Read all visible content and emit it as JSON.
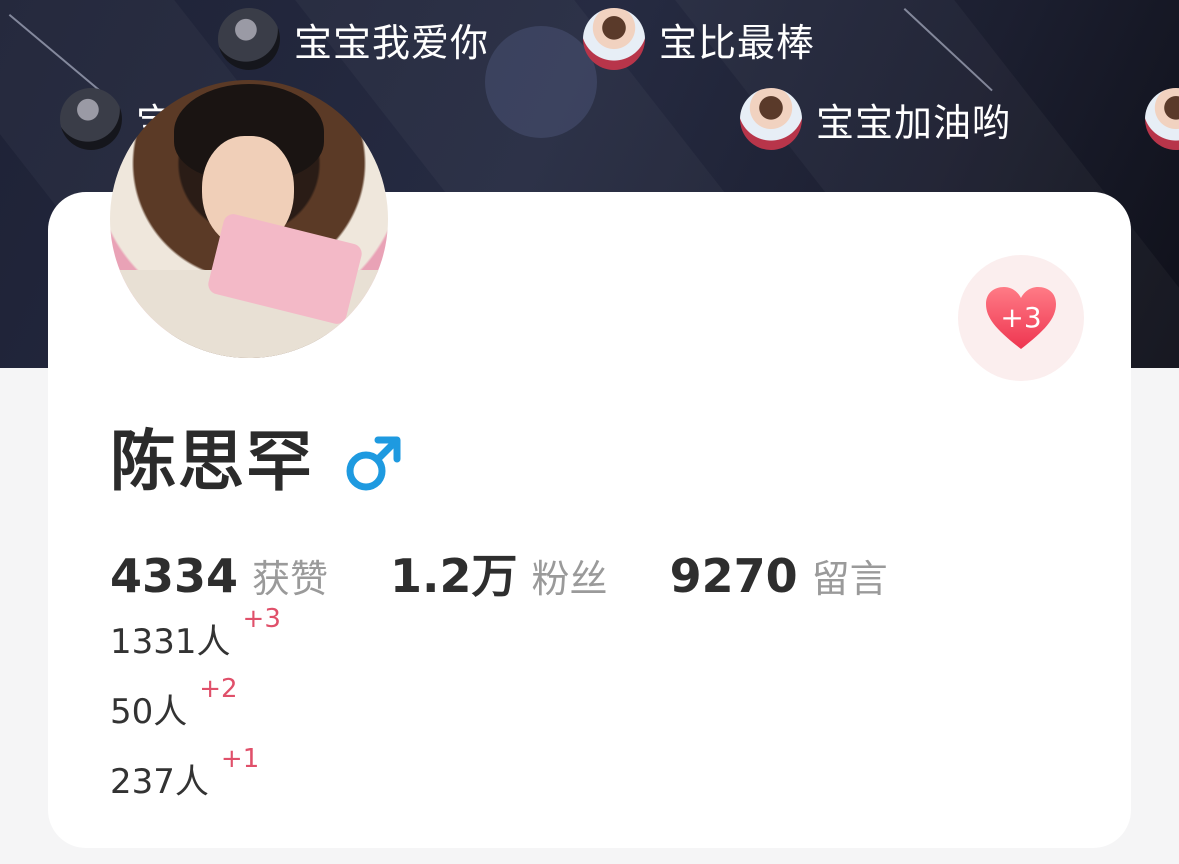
{
  "colors": {
    "banner_bg": "#22263a",
    "accent_red": "#e0506a",
    "gender_blue": "#1e9ae0",
    "heart_red": "#f04a5e"
  },
  "barrage": [
    {
      "avatar": "avatar-dark",
      "text": "宝宝我爱你"
    },
    {
      "avatar": "avatar-light",
      "text": "宝比最棒"
    },
    {
      "avatar": "avatar-dark",
      "text": "宝...心"
    },
    {
      "avatar": "avatar-light",
      "text": "宝宝加油哟"
    },
    {
      "avatar": "avatar-light",
      "text": ""
    }
  ],
  "profile": {
    "name": "陈思罕",
    "gender_icon": "male-icon",
    "like_badge": "+3"
  },
  "stats": [
    {
      "value": "4334",
      "label": "获赞"
    },
    {
      "value": "1.2万",
      "label": "粉丝"
    },
    {
      "value": "9270",
      "label": "留言"
    }
  ],
  "list": [
    {
      "count": "1331人",
      "delta": "+3"
    },
    {
      "count": "50人",
      "delta": "+2"
    },
    {
      "count": "237人",
      "delta": "+1"
    }
  ]
}
